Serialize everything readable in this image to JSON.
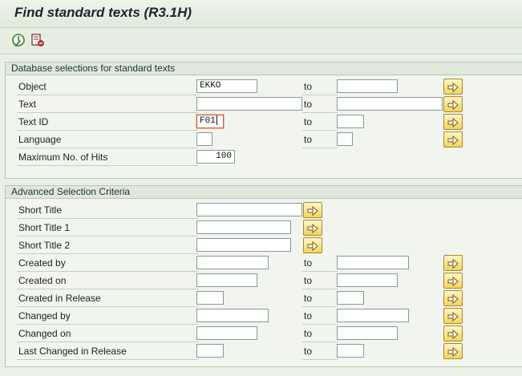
{
  "window": {
    "title": "Find standard texts (R3.1H)"
  },
  "toolbar": {
    "execute_icon": "execute-clock-icon",
    "variant_icon": "get-variant-icon"
  },
  "section_db": {
    "title": "Database selections for standard texts",
    "to_label": "to",
    "rows": {
      "object": {
        "label": "Object",
        "from": "EKKO",
        "to": ""
      },
      "text": {
        "label": "Text",
        "from": "",
        "to": ""
      },
      "text_id": {
        "label": "Text ID",
        "from": "F01",
        "to": ""
      },
      "language": {
        "label": "Language",
        "from": "",
        "to": ""
      },
      "max_hits": {
        "label": "Maximum No. of Hits",
        "value": "100"
      }
    }
  },
  "section_adv": {
    "title": "Advanced Selection Criteria",
    "to_label": "to",
    "rows": {
      "short_title": {
        "label": "Short Title",
        "value": ""
      },
      "short_title_1": {
        "label": "Short Title 1",
        "value": ""
      },
      "short_title_2": {
        "label": "Short Title 2",
        "value": ""
      },
      "created_by": {
        "label": "Created by",
        "from": "",
        "to": ""
      },
      "created_on": {
        "label": "Created on",
        "from": "",
        "to": ""
      },
      "created_release": {
        "label": "Created in Release",
        "from": "",
        "to": ""
      },
      "changed_by": {
        "label": "Changed by",
        "from": "",
        "to": ""
      },
      "changed_on": {
        "label": "Changed on",
        "from": "",
        "to": ""
      },
      "last_changed_release": {
        "label": "Last Changed in Release",
        "from": "",
        "to": ""
      }
    }
  },
  "colors": {
    "accent": "#f3d35e",
    "background": "#e9f0e5",
    "active_border": "#c8643c"
  },
  "icons": {
    "multiple_selection": "arrow-right-icon"
  }
}
